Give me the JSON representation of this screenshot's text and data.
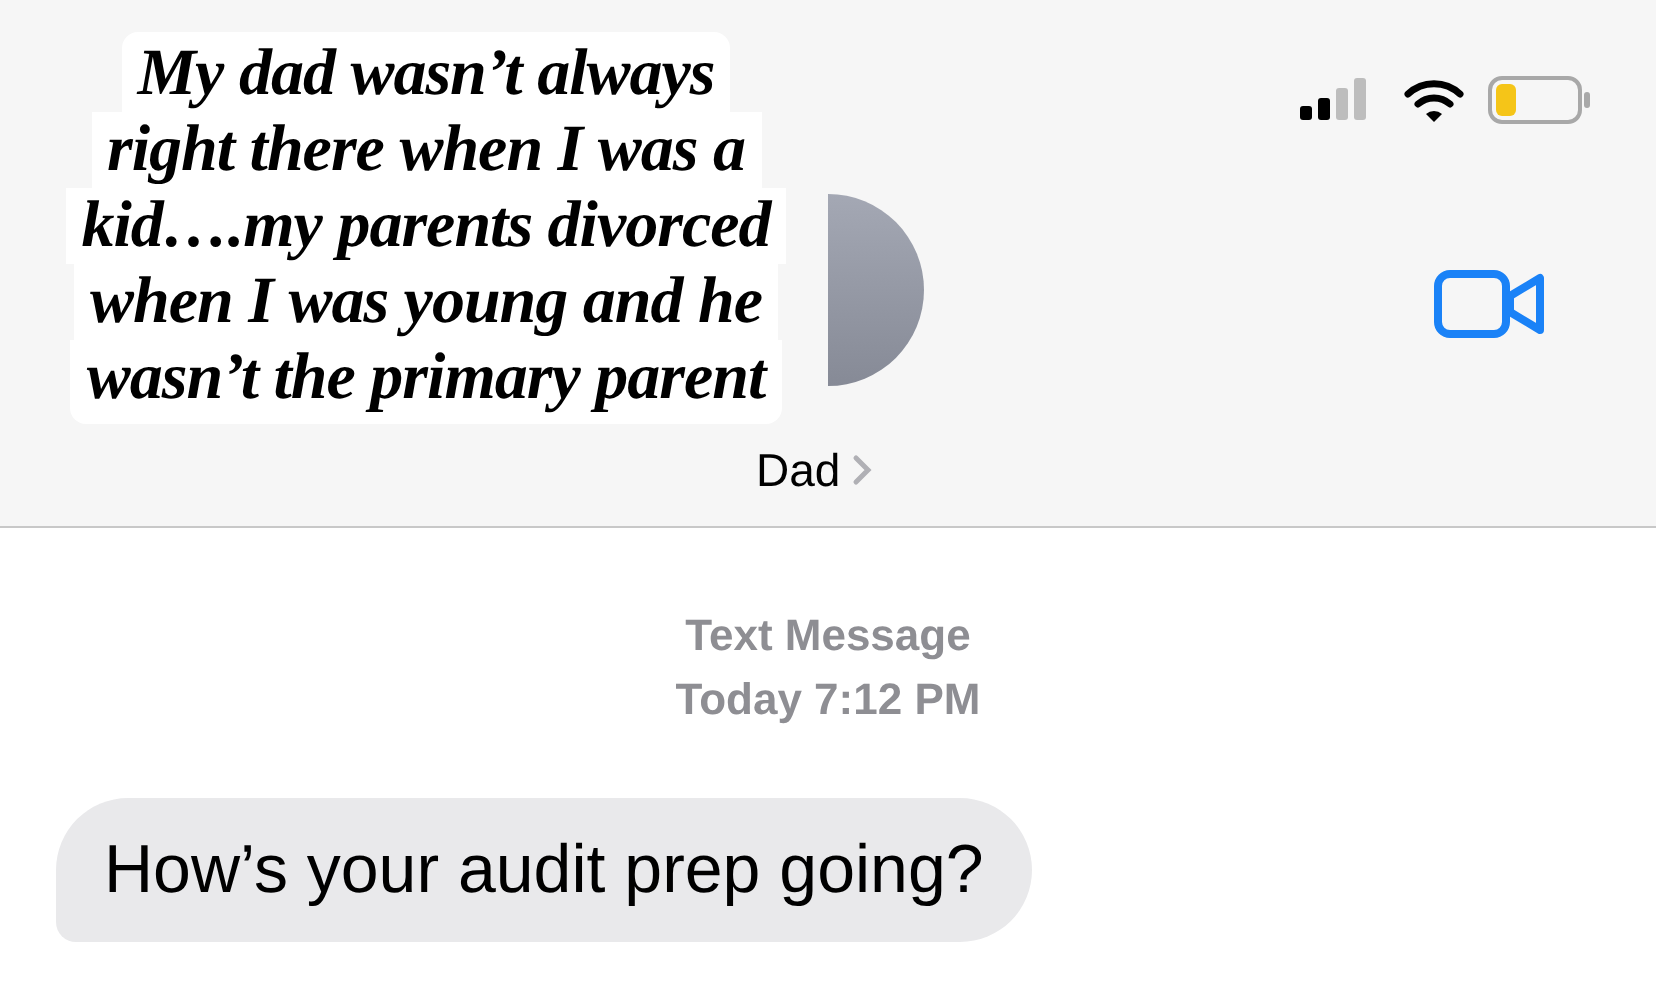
{
  "caption": {
    "lines": [
      "My dad wasn’t always",
      "right there when I was a",
      "kid….my parents divorced",
      "when I was young and he",
      "wasn’t the primary parent"
    ]
  },
  "header": {
    "contact_name": "Dad"
  },
  "conversation": {
    "service": "Text Message",
    "day": "Today",
    "time": "7:12 PM",
    "messages": [
      {
        "kind": "incoming",
        "text": "How’s your audit prep going?"
      }
    ]
  }
}
